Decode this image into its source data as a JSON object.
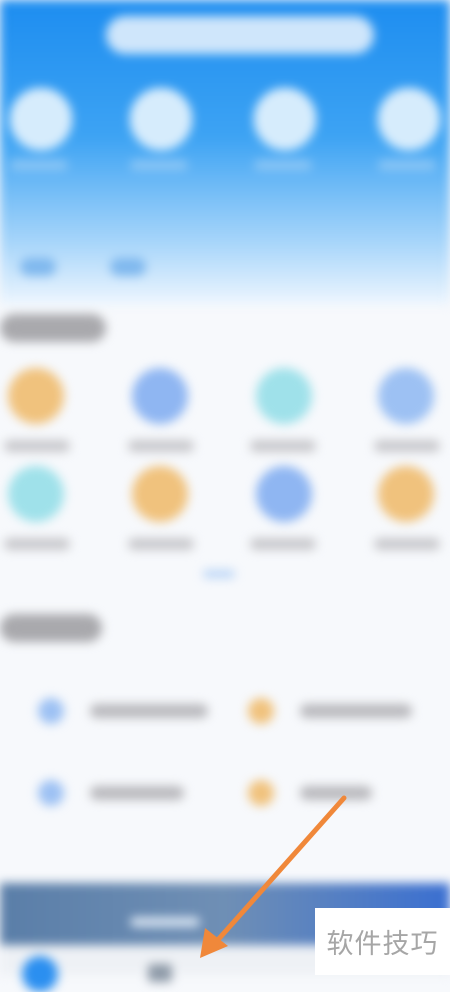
{
  "watermark": {
    "text": "软件技巧"
  },
  "colors": {
    "header_blue": "#1d8df0",
    "arrow_orange": "#f0883a",
    "icon_orange": "#f0c27d",
    "icon_blue": "#8fb6f2",
    "icon_cyan": "#9fe1ea"
  },
  "icons": {
    "search": "search-bar",
    "home_tab": "home-icon",
    "doc_tab": "document-icon",
    "pointer": "orange-arrow"
  }
}
